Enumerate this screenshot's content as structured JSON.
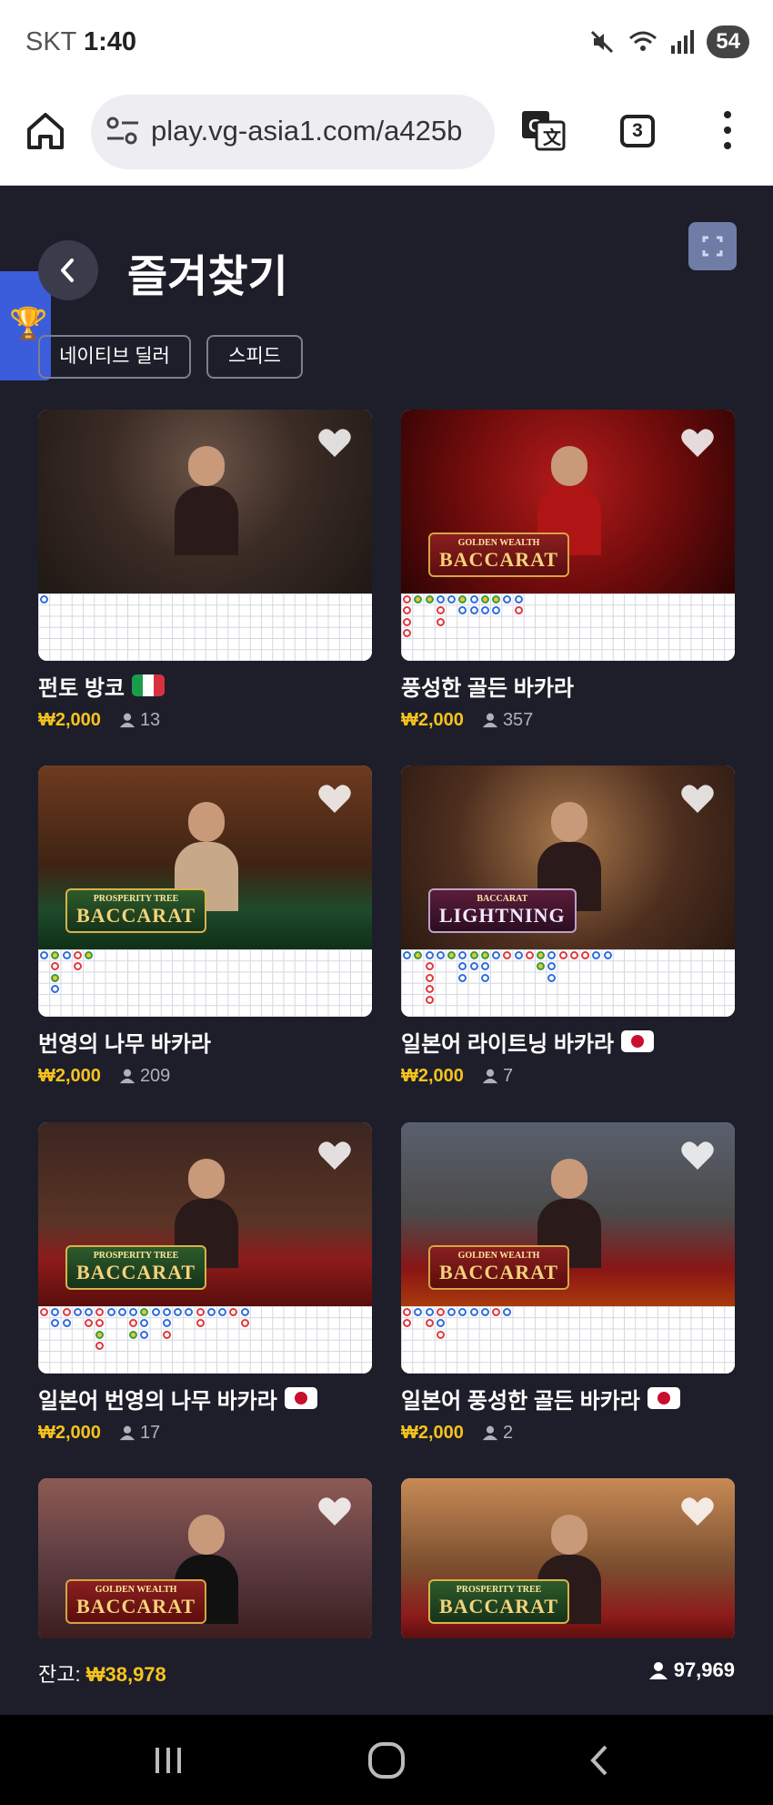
{
  "status_bar": {
    "carrier": "SKT",
    "time": "1:40",
    "battery": "54"
  },
  "browser": {
    "url": "play.vg-asia1.com/a425b",
    "tab_count": "3"
  },
  "header": {
    "title": "즐겨찾기"
  },
  "filters": [
    "네이티브 딜러",
    "스피드"
  ],
  "games": [
    {
      "title": "펀토 방코",
      "flag": "italy",
      "price": "₩2,000",
      "players": "13",
      "logo": "",
      "logo_sub": "",
      "scene": "classic",
      "beads": [
        [
          0,
          0,
          "b"
        ]
      ]
    },
    {
      "title": "풍성한 골든 바카라",
      "flag": "",
      "price": "₩2,000",
      "players": "357",
      "logo": "BACCARAT",
      "logo_sub": "GOLDEN WEALTH",
      "scene": "red",
      "beads": [
        [
          0,
          0,
          "r"
        ],
        [
          1,
          0,
          "g"
        ],
        [
          2,
          0,
          "g"
        ],
        [
          3,
          0,
          "b"
        ],
        [
          4,
          0,
          "b"
        ],
        [
          5,
          0,
          "g"
        ],
        [
          6,
          0,
          "b"
        ],
        [
          7,
          0,
          "g"
        ],
        [
          8,
          0,
          "g"
        ],
        [
          9,
          0,
          "b"
        ],
        [
          10,
          0,
          "b"
        ],
        [
          0,
          1,
          "r"
        ],
        [
          0,
          2,
          "r"
        ],
        [
          0,
          3,
          "r"
        ],
        [
          3,
          1,
          "r"
        ],
        [
          5,
          1,
          "b"
        ],
        [
          6,
          1,
          "b"
        ],
        [
          7,
          1,
          "b"
        ],
        [
          8,
          1,
          "b"
        ],
        [
          10,
          1,
          "r"
        ],
        [
          3,
          2,
          "r"
        ]
      ]
    },
    {
      "title": "번영의 나무 바카라",
      "flag": "",
      "price": "₩2,000",
      "players": "209",
      "logo": "BACCARAT",
      "logo_sub": "PROSPERITY TREE",
      "scene": "green",
      "beads": [
        [
          0,
          0,
          "b"
        ],
        [
          1,
          0,
          "g"
        ],
        [
          2,
          0,
          "b"
        ],
        [
          3,
          0,
          "r"
        ],
        [
          4,
          0,
          "g"
        ],
        [
          1,
          1,
          "r"
        ],
        [
          1,
          2,
          "g"
        ],
        [
          1,
          3,
          "b"
        ],
        [
          3,
          1,
          "r"
        ]
      ]
    },
    {
      "title": "일본어 라이트닝 바카라",
      "flag": "japan",
      "price": "₩2,000",
      "players": "7",
      "logo": "LIGHTNING",
      "logo_sub": "BACCARAT",
      "scene": "gold",
      "beads": [
        [
          0,
          0,
          "b"
        ],
        [
          1,
          0,
          "g"
        ],
        [
          2,
          0,
          "b"
        ],
        [
          3,
          0,
          "b"
        ],
        [
          4,
          0,
          "g"
        ],
        [
          5,
          0,
          "b"
        ],
        [
          6,
          0,
          "g"
        ],
        [
          7,
          0,
          "g"
        ],
        [
          8,
          0,
          "b"
        ],
        [
          9,
          0,
          "r"
        ],
        [
          10,
          0,
          "b"
        ],
        [
          11,
          0,
          "r"
        ],
        [
          12,
          0,
          "g"
        ],
        [
          13,
          0,
          "b"
        ],
        [
          14,
          0,
          "r"
        ],
        [
          15,
          0,
          "r"
        ],
        [
          16,
          0,
          "r"
        ],
        [
          17,
          0,
          "b"
        ],
        [
          18,
          0,
          "b"
        ],
        [
          2,
          1,
          "r"
        ],
        [
          2,
          2,
          "r"
        ],
        [
          2,
          3,
          "r"
        ],
        [
          2,
          4,
          "r"
        ],
        [
          5,
          1,
          "b"
        ],
        [
          6,
          1,
          "b"
        ],
        [
          7,
          1,
          "b"
        ],
        [
          5,
          2,
          "b"
        ],
        [
          7,
          2,
          "b"
        ],
        [
          12,
          1,
          "g"
        ],
        [
          13,
          1,
          "b"
        ],
        [
          13,
          2,
          "b"
        ]
      ]
    },
    {
      "title": "일본어 번영의 나무 바카라",
      "flag": "japan",
      "price": "₩2,000",
      "players": "17",
      "logo": "BACCARAT",
      "logo_sub": "PROSPERITY TREE",
      "scene": "asia",
      "beads": [
        [
          0,
          0,
          "r"
        ],
        [
          1,
          0,
          "b"
        ],
        [
          2,
          0,
          "r"
        ],
        [
          3,
          0,
          "b"
        ],
        [
          4,
          0,
          "b"
        ],
        [
          5,
          0,
          "r"
        ],
        [
          6,
          0,
          "b"
        ],
        [
          7,
          0,
          "b"
        ],
        [
          8,
          0,
          "b"
        ],
        [
          9,
          0,
          "g"
        ],
        [
          10,
          0,
          "b"
        ],
        [
          11,
          0,
          "b"
        ],
        [
          12,
          0,
          "b"
        ],
        [
          13,
          0,
          "b"
        ],
        [
          14,
          0,
          "r"
        ],
        [
          15,
          0,
          "b"
        ],
        [
          16,
          0,
          "b"
        ],
        [
          17,
          0,
          "r"
        ],
        [
          18,
          0,
          "b"
        ],
        [
          1,
          1,
          "b"
        ],
        [
          2,
          1,
          "b"
        ],
        [
          4,
          1,
          "r"
        ],
        [
          5,
          1,
          "r"
        ],
        [
          8,
          1,
          "r"
        ],
        [
          9,
          1,
          "b"
        ],
        [
          11,
          1,
          "b"
        ],
        [
          14,
          1,
          "r"
        ],
        [
          18,
          1,
          "r"
        ],
        [
          5,
          2,
          "g"
        ],
        [
          8,
          2,
          "g"
        ],
        [
          9,
          2,
          "b"
        ],
        [
          11,
          2,
          "r"
        ],
        [
          5,
          3,
          "r"
        ]
      ]
    },
    {
      "title": "일본어 풍성한 골든 바카라",
      "flag": "japan",
      "price": "₩2,000",
      "players": "2",
      "logo": "BACCARAT",
      "logo_sub": "GOLDEN WEALTH",
      "scene": "orange",
      "beads": [
        [
          0,
          0,
          "r"
        ],
        [
          1,
          0,
          "b"
        ],
        [
          2,
          0,
          "b"
        ],
        [
          3,
          0,
          "r"
        ],
        [
          4,
          0,
          "b"
        ],
        [
          5,
          0,
          "b"
        ],
        [
          6,
          0,
          "b"
        ],
        [
          7,
          0,
          "b"
        ],
        [
          8,
          0,
          "r"
        ],
        [
          9,
          0,
          "b"
        ],
        [
          0,
          1,
          "r"
        ],
        [
          2,
          1,
          "r"
        ],
        [
          3,
          1,
          "b"
        ],
        [
          3,
          2,
          "r"
        ]
      ]
    },
    {
      "title": "",
      "flag": "",
      "price": "",
      "players": "",
      "logo": "BACCARAT",
      "logo_sub": "GOLDEN WEALTH",
      "scene": "red2",
      "beads": []
    },
    {
      "title": "",
      "flag": "",
      "price": "",
      "players": "",
      "logo": "BACCARAT",
      "logo_sub": "PROSPERITY TREE",
      "scene": "sunset",
      "beads": []
    }
  ],
  "footer": {
    "balance_label": "잔고:",
    "balance_value": "₩38,978",
    "online_count": "97,969"
  },
  "colors": {
    "background": "#1d1e2a",
    "price": "#f7c31d",
    "accent": "#3b5ddb"
  }
}
